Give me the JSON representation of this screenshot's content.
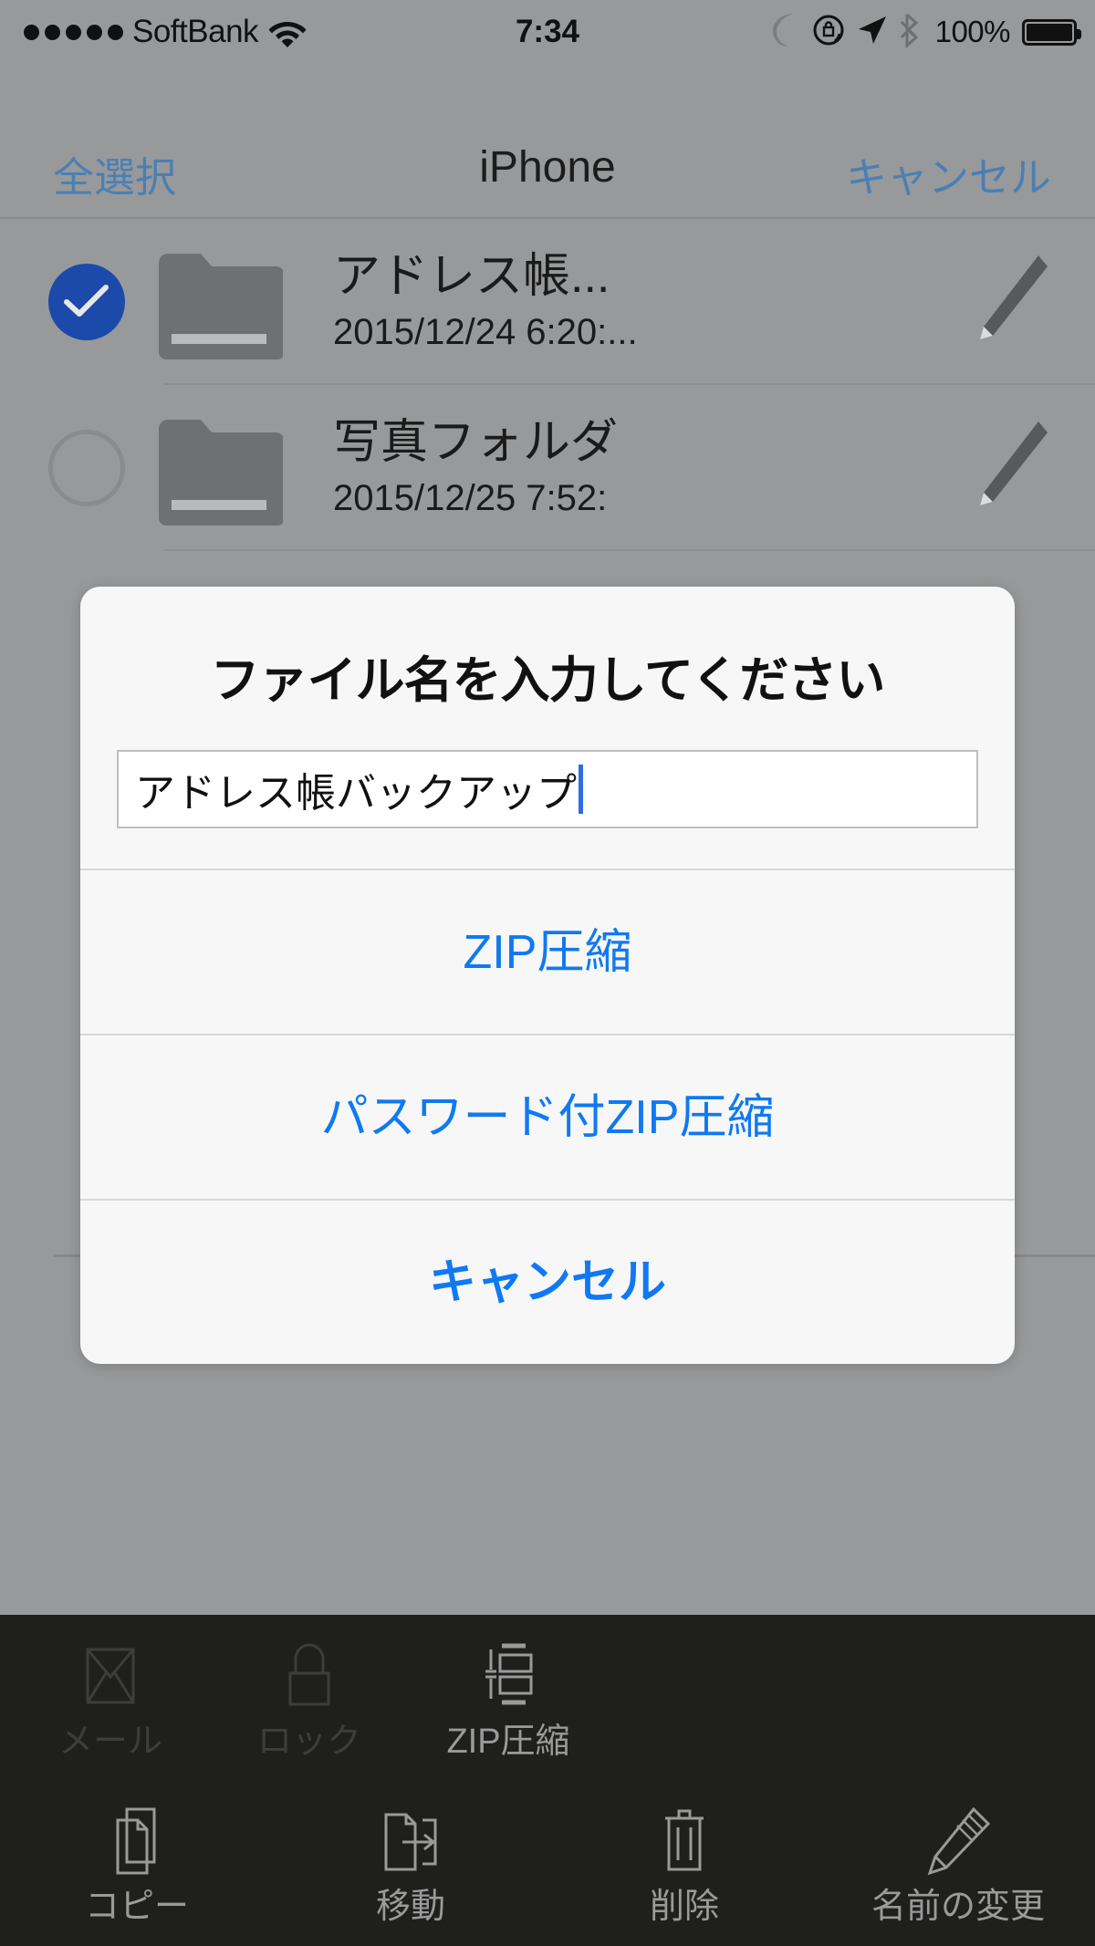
{
  "status_bar": {
    "signal_dots": 5,
    "carrier": "SoftBank",
    "wifi_icon": "wifi-icon",
    "time": "7:34",
    "dnd_icon": "moon-icon",
    "rotation_lock_icon": "rotation-lock-icon",
    "location_icon": "location-arrow-icon",
    "bluetooth_icon": "bluetooth-icon",
    "battery_percent": "100%",
    "battery_icon": "battery-full-icon"
  },
  "nav": {
    "select_all_label": "全選択",
    "title": "iPhone",
    "cancel_label": "キャンセル"
  },
  "file_list": {
    "rows": [
      {
        "checked": true,
        "icon": "folder-icon",
        "name": "アドレス帳...",
        "date": "2015/12/24 6:20:...",
        "edit_icon": "pencil-icon"
      },
      {
        "checked": false,
        "icon": "folder-icon",
        "name": "写真フォルダ",
        "date": "2015/12/25 7:52:",
        "edit_icon": "pencil-icon"
      }
    ]
  },
  "dialog": {
    "title": "ファイル名を入力してください",
    "input_value": "アドレス帳バックアップ",
    "input_placeholder": "",
    "buttons": [
      {
        "label": "ZIP圧縮",
        "bold": false
      },
      {
        "label": "パスワード付ZIP圧縮",
        "bold": false
      },
      {
        "label": "キャンセル",
        "bold": true
      }
    ]
  },
  "toolbar": {
    "row1": [
      {
        "label": "メール",
        "icon": "mail-icon",
        "enabled": false
      },
      {
        "label": "ロック",
        "icon": "lock-icon",
        "enabled": false
      },
      {
        "label": "ZIP圧縮",
        "icon": "zip-compress-icon",
        "enabled": true
      }
    ],
    "row2": [
      {
        "label": "コピー",
        "icon": "copy-icon",
        "enabled": true
      },
      {
        "label": "移動",
        "icon": "move-icon",
        "enabled": true
      },
      {
        "label": "削除",
        "icon": "trash-icon",
        "enabled": true
      },
      {
        "label": "名前の変更",
        "icon": "rename-pencil-icon",
        "enabled": true
      }
    ]
  },
  "colors": {
    "dimmed_background": "#98999a",
    "accent_blue": "#1079f2",
    "nav_blue": "#4a7fb5",
    "checked_blue": "#1b4aab",
    "toolbar_background": "#1f1f1e",
    "dialog_background": "#f7f7f7"
  }
}
